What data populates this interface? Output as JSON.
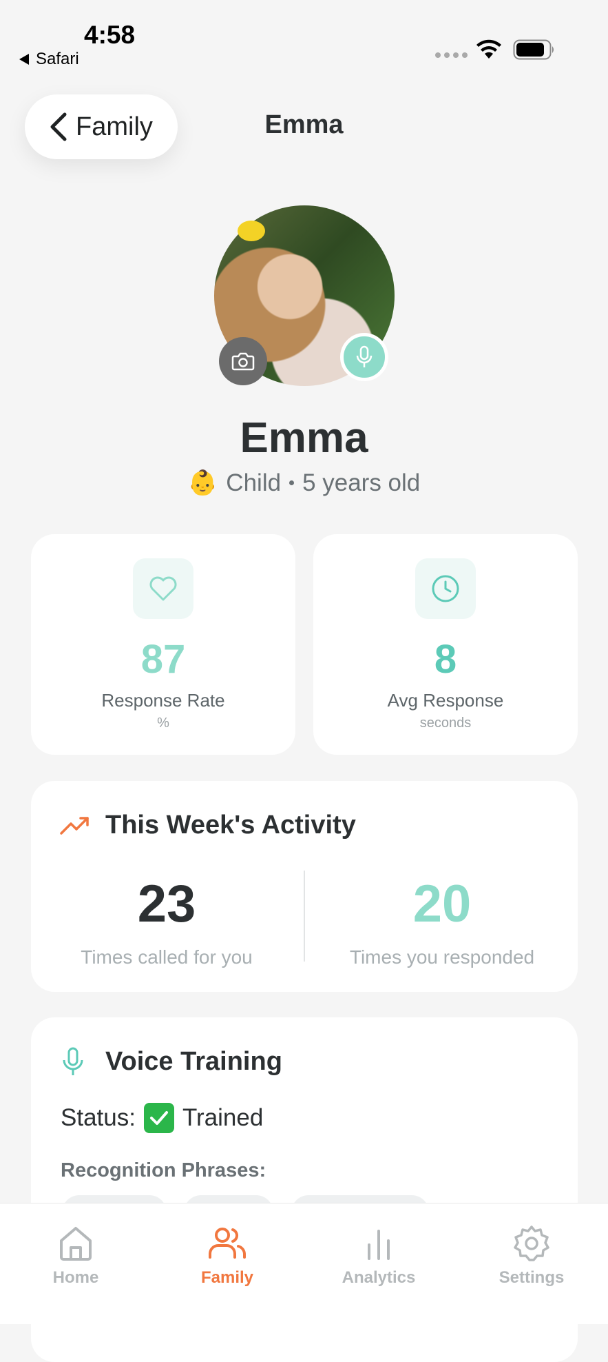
{
  "status_bar": {
    "time": "4:58",
    "back_app": "Safari"
  },
  "header": {
    "back_label": "Family",
    "title": "Emma"
  },
  "profile": {
    "name": "Emma",
    "emoji": "👶",
    "role": "Child",
    "age": "5 years old"
  },
  "stats": [
    {
      "icon": "heart-icon",
      "value": "87",
      "label": "Response Rate",
      "unit": "%",
      "color": "#8ddbc9"
    },
    {
      "icon": "clock-icon",
      "value": "8",
      "label": "Avg Response",
      "unit": "seconds",
      "color": "#5ccab7"
    }
  ],
  "activity": {
    "title": "This Week's Activity",
    "called_value": "23",
    "called_label": "Times called for you",
    "responded_value": "20",
    "responded_label": "Times you responded"
  },
  "voice": {
    "title": "Voice Training",
    "status_prefix": "Status:",
    "status_value": "Trained",
    "phrases_label": "Recognition Phrases:"
  },
  "tabs": [
    {
      "label": "Home",
      "icon": "home-icon",
      "active": false
    },
    {
      "label": "Family",
      "icon": "family-icon",
      "active": true
    },
    {
      "label": "Analytics",
      "icon": "analytics-icon",
      "active": false
    },
    {
      "label": "Settings",
      "icon": "settings-icon",
      "active": false
    }
  ],
  "colors": {
    "accent_teal": "#8ddbc9",
    "accent_orange": "#f1773f",
    "text_dark": "#2c3032"
  }
}
